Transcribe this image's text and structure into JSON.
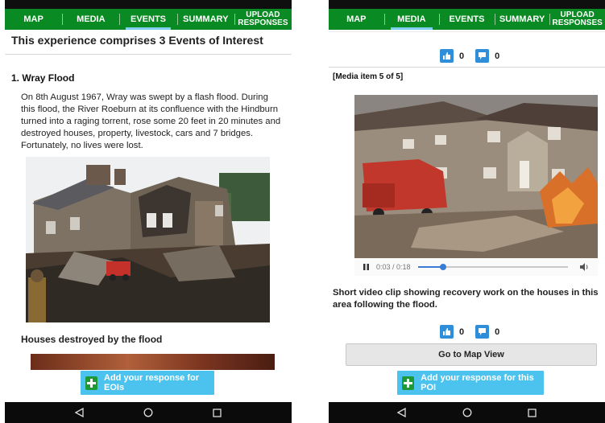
{
  "left": {
    "tabs": [
      {
        "label": "MAP",
        "active": false
      },
      {
        "label": "MEDIA",
        "active": false
      },
      {
        "label": "EVENTS",
        "active": true
      },
      {
        "label": "SUMMARY",
        "active": false
      },
      {
        "label_line1": "UPLOAD",
        "label_line2": "RESPONSES",
        "active": false
      }
    ],
    "header": "This experience comprises 3 Events of Interest",
    "event": {
      "title": "1. Wray Flood",
      "description": "On 8th August 1967, Wray was swept by a flash flood. During this flood, the River Roeburn at its confluence with the Hindburn turned into a raging torrent, rose some 20 feet in 20 minutes and destroyed houses, property, livestock, cars and 7 bridges. Fortunately, no lives were lost.",
      "image_caption": "Houses destroyed by the flood"
    },
    "add_button_label": "Add your response for EOIs"
  },
  "right": {
    "tabs": [
      {
        "label": "MAP",
        "active": false
      },
      {
        "label": "MEDIA",
        "active": true
      },
      {
        "label": "EVENTS",
        "active": false
      },
      {
        "label": "SUMMARY",
        "active": false
      },
      {
        "label_line1": "UPLOAD",
        "label_line2": "RESPONSES",
        "active": false
      }
    ],
    "votes_top": {
      "up": "0",
      "comment": "0"
    },
    "media_count": "[Media item 5 of 5]",
    "video": {
      "time": "0:03 / 0:18",
      "progress": 0.17
    },
    "caption": "Short video clip showing recovery work on the houses in this area following the flood.",
    "votes_bottom": {
      "up": "0",
      "comment": "0"
    },
    "map_button_label": "Go to Map View",
    "add_button_label": "Add your response for this POI"
  },
  "colors": {
    "tab_bar": "#0a8a22",
    "tab_active_indicator": "#7fd0ef",
    "add_button": "#4cc3ee",
    "plus_icon_bg": "#1d9a37",
    "vote_icon": "#2f8ed9"
  },
  "icons": [
    "back-icon",
    "home-icon",
    "recents-icon",
    "thumbs-up-icon",
    "comment-icon",
    "plus-icon",
    "pause-icon",
    "volume-icon"
  ]
}
